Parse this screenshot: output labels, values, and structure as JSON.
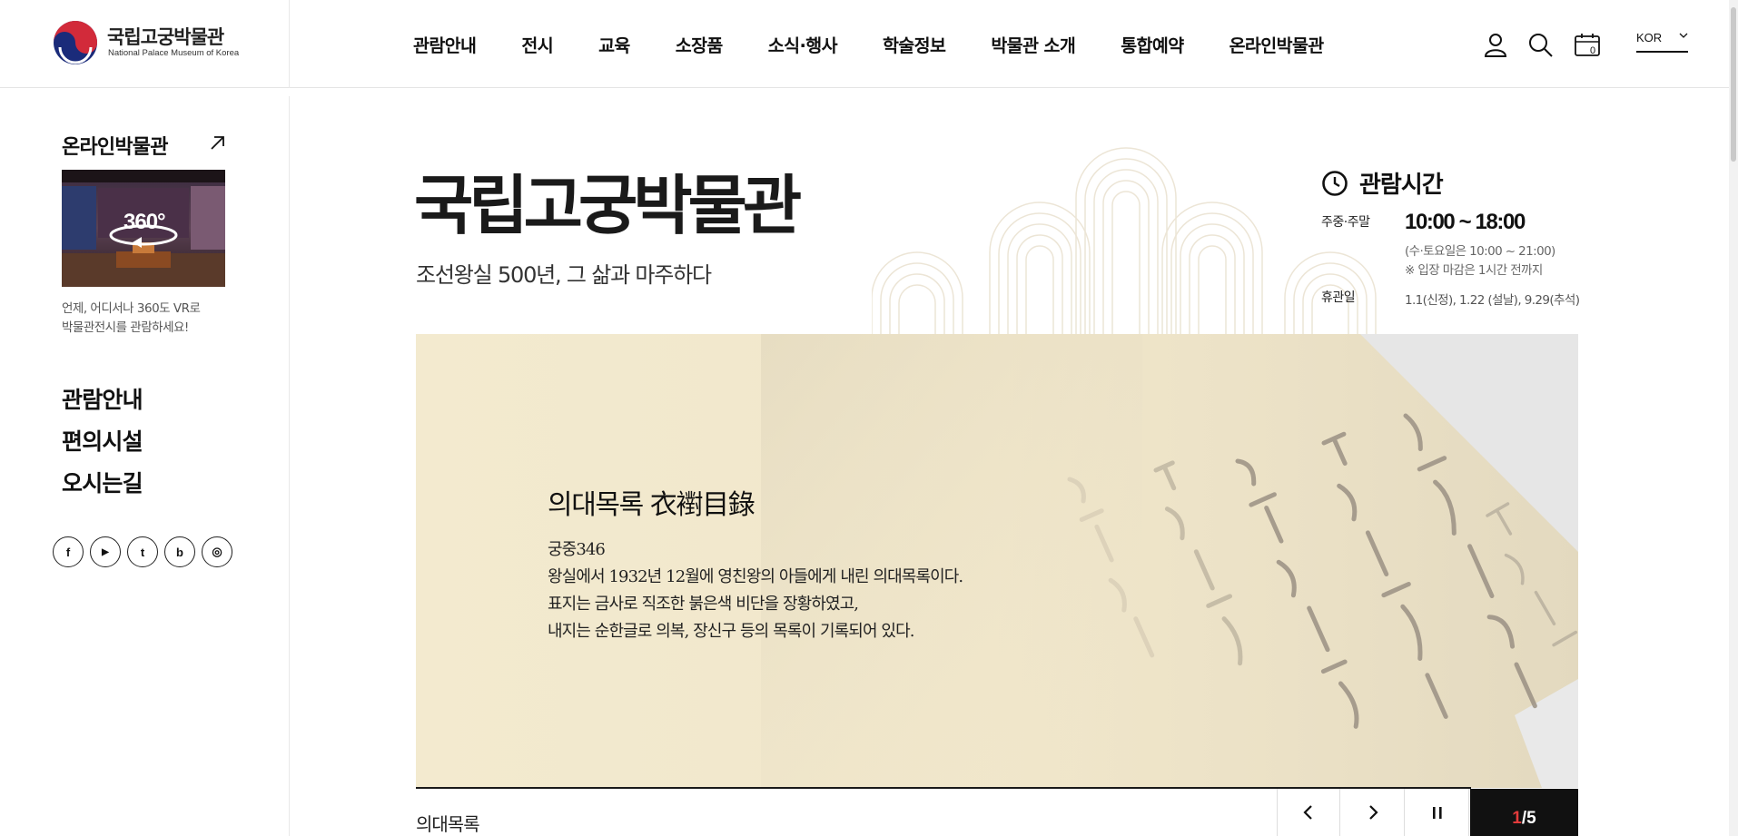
{
  "header": {
    "logo_ko": "국립고궁박물관",
    "logo_en": "National Palace Museum of Korea",
    "nav": [
      "관람안내",
      "전시",
      "교육",
      "소장품",
      "소식·행사",
      "학술정보",
      "박물관 소개",
      "통합예약",
      "온라인박물관"
    ],
    "utils": [
      "user-icon",
      "search-icon",
      "calendar-icon"
    ],
    "calendar_badge": "0",
    "lang": "KOR"
  },
  "sidebar": {
    "online_title": "온라인박물관",
    "vr_label": "360°",
    "vr_desc_1": "언제, 어디서나 360도 VR로",
    "vr_desc_2": "박물관전시를 관람하세요!",
    "menu": [
      "관람안내",
      "편의시설",
      "오시는길"
    ],
    "sns": [
      {
        "icon": "facebook-icon",
        "glyph": "f"
      },
      {
        "icon": "youtube-icon",
        "glyph": "▶"
      },
      {
        "icon": "twitter-icon",
        "glyph": "t"
      },
      {
        "icon": "blog-icon",
        "glyph": "b"
      },
      {
        "icon": "instagram-icon",
        "glyph": "◎"
      }
    ]
  },
  "main": {
    "title": "국립고궁박물관",
    "subtitle": "조선왕실 500년, 그 삶과 마주하다"
  },
  "hours": {
    "title": "관람시간",
    "weekday_label": "주중·주말",
    "time": "10:00 ~ 18:00",
    "note_1": "(수·토요일은 10:00 ~ 21:00)",
    "note_2": "※ 입장 마감은 1시간 전까지",
    "closed_label": "휴관일",
    "closed_days": "1.1(신정), 1.22 (설날), 9.29(추석)"
  },
  "hero": {
    "title": "의대목록 衣襨目錄",
    "line_1": "궁중346",
    "line_2": "왕실에서 1932년 12월에 영친왕의 아들에게 내린 의대목록이다.",
    "line_3": "표지는 금사로 직조한 붉은색 비단을 장황하였고,",
    "line_4": "내지는 순한글로 의복, 장신구 등의 목록이 기록되어 있다.",
    "caption": "의대목록",
    "current": "1",
    "separator": "/",
    "total": "5"
  },
  "colors": {
    "accent_red": "#e33b3b",
    "text_dark": "#111111",
    "hero_bg": "#f1e8cf",
    "pattern": "#e9e2d3"
  }
}
